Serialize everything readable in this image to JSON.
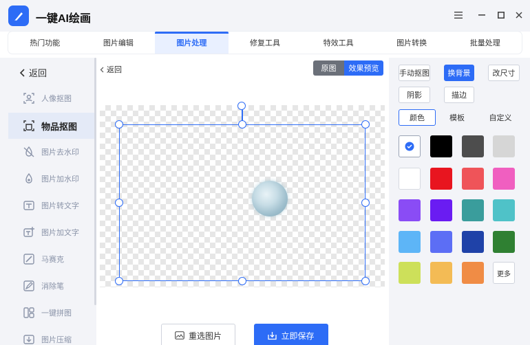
{
  "app": {
    "title": "一键AI绘画"
  },
  "tabs": [
    {
      "label": "热门功能"
    },
    {
      "label": "图片编辑"
    },
    {
      "label": "图片处理"
    },
    {
      "label": "修复工具"
    },
    {
      "label": "特效工具"
    },
    {
      "label": "图片转换"
    },
    {
      "label": "批量处理"
    }
  ],
  "active_tab": "图片处理",
  "sidebar": {
    "back_label": "返回",
    "items": [
      {
        "label": "人像抠图",
        "icon": "portrait-cutout-icon"
      },
      {
        "label": "物品抠图",
        "icon": "object-cutout-icon"
      },
      {
        "label": "图片去水印",
        "icon": "remove-watermark-icon"
      },
      {
        "label": "图片加水印",
        "icon": "add-watermark-icon"
      },
      {
        "label": "图片转文字",
        "icon": "image-to-text-icon"
      },
      {
        "label": "图片加文字",
        "icon": "add-text-icon"
      },
      {
        "label": "马赛克",
        "icon": "mosaic-icon"
      },
      {
        "label": "消除笔",
        "icon": "eraser-pen-icon"
      },
      {
        "label": "一键拼图",
        "icon": "collage-icon"
      },
      {
        "label": "图片压缩",
        "icon": "compress-icon"
      }
    ],
    "active_item": "物品抠图"
  },
  "canvas": {
    "back_label": "返回",
    "view_original": "原图",
    "view_preview": "效果预览",
    "reselect_label": "重选图片",
    "save_label": "立即保存"
  },
  "right_panel": {
    "buttons": {
      "manual_cutout": "手动抠图",
      "change_bg": "换背景",
      "resize": "改尺寸",
      "shadow": "阴影",
      "stroke": "描边"
    },
    "segments": [
      "颜色",
      "模板",
      "自定义"
    ],
    "active_segment": "颜色",
    "swatches": [
      "transparent",
      "#000000",
      "#4d4d4d",
      "#d6d6d6",
      "#ffffff",
      "#e8151f",
      "#ef5459",
      "#f05fc0",
      "#8a4cf5",
      "#6a1cf2",
      "#3a9d9c",
      "#4fc2c8",
      "#5db5f7",
      "#5c6ef5",
      "#1f42a8",
      "#2f8032",
      "#cde05a",
      "#f3bb55",
      "#f08c45"
    ],
    "more_label": "更多"
  },
  "colors": {
    "accent": "#2d6cf6",
    "sidebar_bg": "#f3f4f8"
  }
}
